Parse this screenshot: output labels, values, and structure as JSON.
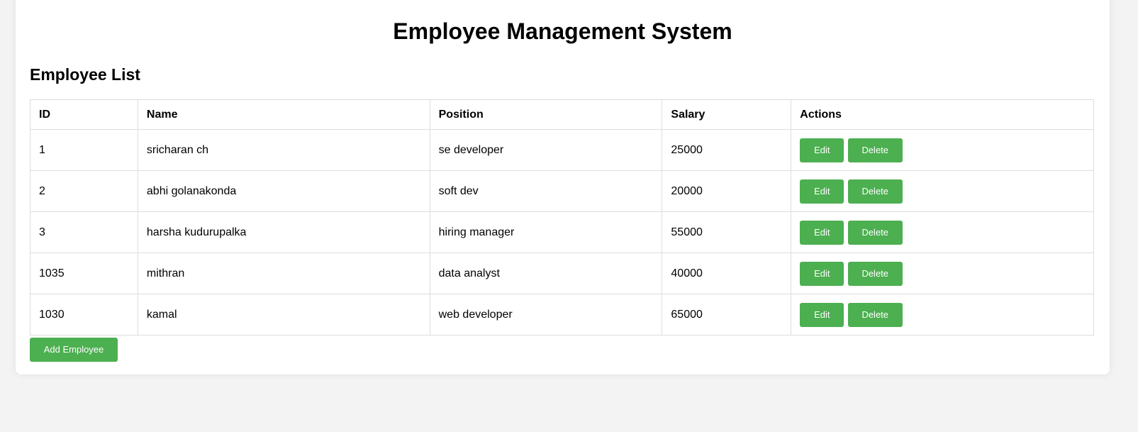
{
  "header": {
    "title": "Employee Management System"
  },
  "list": {
    "title": "Employee List",
    "columns": [
      "ID",
      "Name",
      "Position",
      "Salary",
      "Actions"
    ],
    "rows": [
      {
        "id": "1",
        "name": "sricharan ch",
        "position": "se developer",
        "salary": "25000"
      },
      {
        "id": "2",
        "name": "abhi golanakonda",
        "position": "soft dev",
        "salary": "20000"
      },
      {
        "id": "3",
        "name": "harsha kudurupalka",
        "position": "hiring manager",
        "salary": "55000"
      },
      {
        "id": "1035",
        "name": "mithran",
        "position": "data analyst",
        "salary": "40000"
      },
      {
        "id": "1030",
        "name": "kamal",
        "position": "web developer",
        "salary": "65000"
      }
    ],
    "edit_label": "Edit",
    "delete_label": "Delete"
  },
  "actions": {
    "add_label": "Add Employee"
  },
  "colors": {
    "accent": "#4caf50",
    "page_bg": "#f3f3f3",
    "card_bg": "#ffffff",
    "border": "#dddddd"
  }
}
